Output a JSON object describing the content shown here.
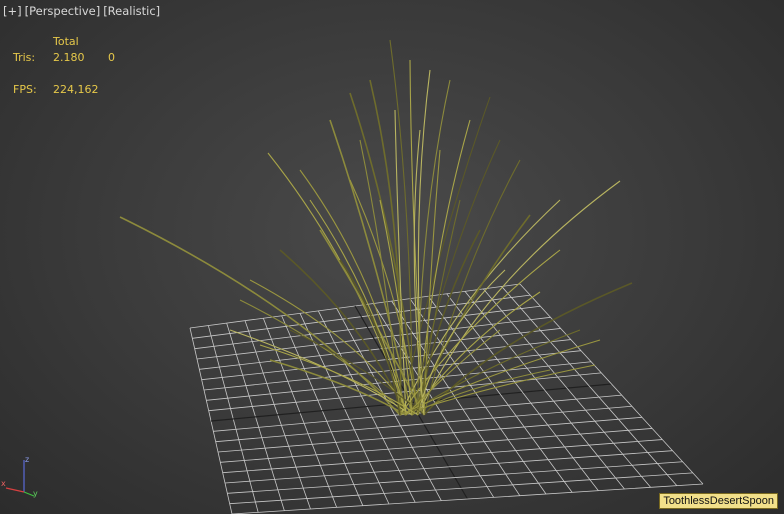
{
  "viewport": {
    "labels": [
      "[+]",
      "[Perspective]",
      "[Realistic]"
    ]
  },
  "stats": {
    "header": "Total",
    "tris_label": "Tris:",
    "tris_value": "2.180",
    "tris_selected": "0",
    "fps_label": "FPS:",
    "fps_value": "224,162"
  },
  "object_tooltip": "ToothlessDesertSpoon",
  "axis": {
    "x": "x",
    "y": "y",
    "z": "z"
  },
  "colors": {
    "background": "#3a3a3a",
    "grid": "#c8c8c8",
    "grass": "#8c8a3c",
    "stats_text": "#e6c84a",
    "tooltip_bg": "#f2e08a"
  }
}
